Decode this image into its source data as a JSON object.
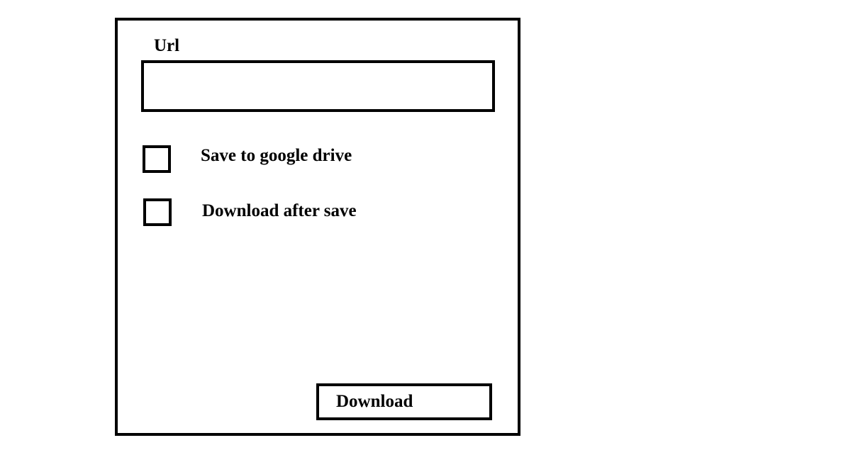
{
  "form": {
    "url_label": "Url",
    "url_value": "",
    "options": [
      {
        "label": "Save to google drive",
        "checked": false
      },
      {
        "label": "Download after save",
        "checked": false
      }
    ],
    "download_label": "Download"
  }
}
